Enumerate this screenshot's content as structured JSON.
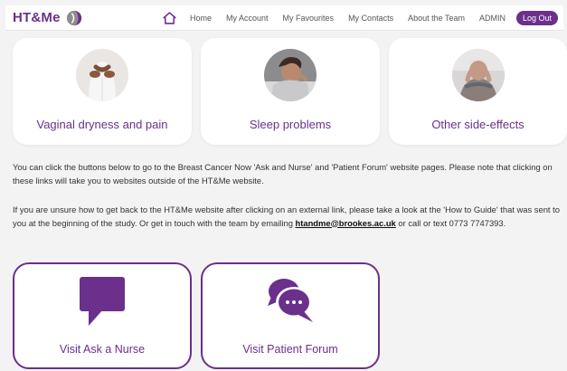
{
  "navbar": {
    "brand": "HT&Me",
    "items": [
      {
        "label": "Home"
      },
      {
        "label": "My Account"
      },
      {
        "label": "My Favourites"
      },
      {
        "label": "My Contacts"
      },
      {
        "label": "About the Team"
      },
      {
        "label": "ADMIN"
      }
    ],
    "logout_label": "Log Out"
  },
  "cards": [
    {
      "label": "Vaginal dryness and pain",
      "icon": "woman-pelvis-photo"
    },
    {
      "label": "Sleep problems",
      "icon": "woman-sleeping-photo"
    },
    {
      "label": "Other side-effects",
      "icon": "woman-head-in-hands-photo"
    }
  ],
  "intro_text": "You can click the buttons below to go to the Breast Cancer Now 'Ask and Nurse' and 'Patient Forum' website pages. Please note that clicking on these links will take you to websites outside of the HT&Me website.",
  "help_text": {
    "before": "If you are unsure how to get back to the HT&Me website after clicking on an external link, please take a look at the 'How to Guide' that was sent to you at the beginning of the study. Or get in touch with the team by emailing ",
    "email": "htandme@brookes.ac.uk",
    "after": " or call or text 0773 7747393."
  },
  "buttons": [
    {
      "label": "Visit Ask a Nurse",
      "icon": "speech-bubble-icon"
    },
    {
      "label": "Visit Patient Forum",
      "icon": "chat-bubbles-icon"
    }
  ],
  "colors": {
    "accent": "#6b2f8c",
    "background": "#f3f3f3",
    "card": "#ffffff"
  }
}
